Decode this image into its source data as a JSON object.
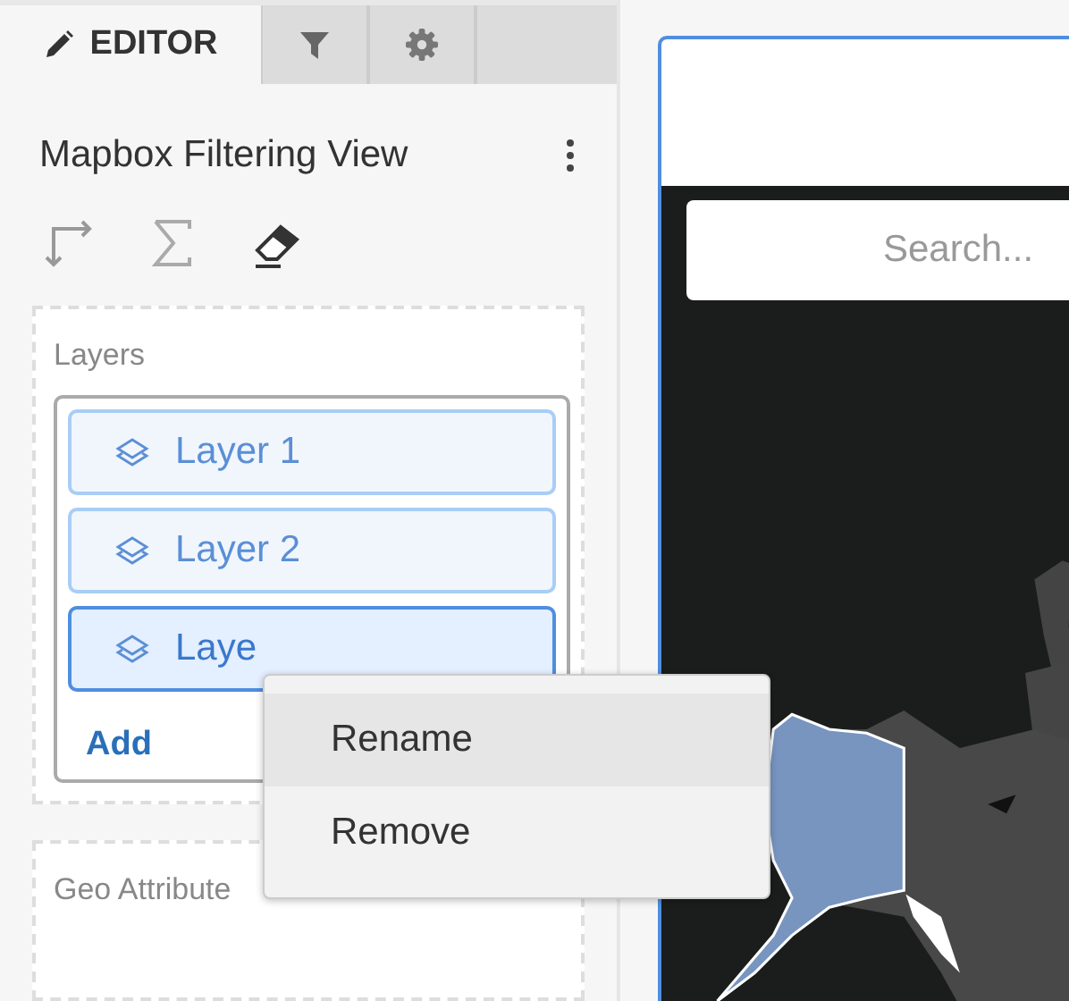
{
  "tabs": [
    {
      "kind": "editor",
      "label": "EDITOR",
      "selected": true
    },
    {
      "kind": "filter",
      "selected": false
    },
    {
      "kind": "settings",
      "selected": false
    }
  ],
  "view_title": "Mapbox Filtering View",
  "layers": {
    "label": "Layers",
    "items": [
      {
        "label": "Layer 1",
        "selected": false
      },
      {
        "label": "Layer 2",
        "selected": false
      },
      {
        "label": "Laye",
        "selected": true
      }
    ],
    "add": "Add"
  },
  "geo_attribute": {
    "label": "Geo Attribute"
  },
  "context_menu": [
    {
      "label": "Rename",
      "hovered": true
    },
    {
      "label": "Remove",
      "hovered": false
    }
  ],
  "map": {
    "search": {
      "placeholder": "Search..."
    },
    "kind": "picture"
  }
}
